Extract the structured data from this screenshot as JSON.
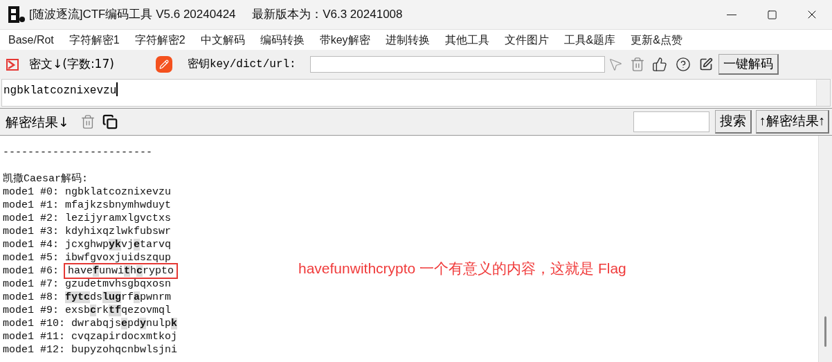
{
  "window": {
    "title": "[随波逐流]CTF编码工具 V5.6 20240424     最新版本为：V6.3 20241008"
  },
  "menu": [
    "Base/Rot",
    "字符解密1",
    "字符解密2",
    "中文解码",
    "编码转换",
    "带key解密",
    "进制转换",
    "其他工具",
    "文件图片",
    "工具&题库",
    "更新&点赞"
  ],
  "toolbar": {
    "cipher_label": "密文↓(字数:17)",
    "key_label": "密钥key/dict/url:",
    "decode_button": "一键解码"
  },
  "input": {
    "value": "ngbklatcoznixevzu"
  },
  "results_bar": {
    "label": "解密结果↓",
    "search_button": "搜索",
    "back_button": "↑解密结果↑"
  },
  "results": [
    {
      "kind": "text",
      "text": "------------------------"
    },
    {
      "kind": "blank"
    },
    {
      "kind": "text",
      "text": "凯撒Caesar解码:"
    },
    {
      "kind": "text",
      "text": "mode1 #0: ngbklatcoznixevzu"
    },
    {
      "kind": "text",
      "text": "mode1 #1: mfajkzsbnymhwduyt"
    },
    {
      "kind": "text",
      "text": "mode1 #2: lezijyramxlgvctxs"
    },
    {
      "kind": "text",
      "text": "mode1 #3: kdyhixqzlwkfubswr"
    },
    {
      "kind": "text",
      "text": "mode1 #4: jcxghwp**yk**vj**e**tarvq"
    },
    {
      "kind": "text",
      "text": "mode1 #5: ibwfgvoxjuidszqup"
    },
    {
      "kind": "text",
      "prefix": "mode1 #6: ",
      "text": "have**f**unwi**t**h**c**rypto",
      "boxed": true
    },
    {
      "kind": "text",
      "text": "mode1 #7: gzudetmvhsgbqxosn"
    },
    {
      "kind": "text",
      "text": "mode1 #8: **fytc**ds**lug**rf**a**pwnrm"
    },
    {
      "kind": "text",
      "text": "mode1 #9: exsb**c**rk**tf**qezovmql"
    },
    {
      "kind": "text",
      "text": "mode1 #10: dwrabqjs**e**pd**y**nulp**k**"
    },
    {
      "kind": "text",
      "text": "mode1 #11: cvqzapirdocxmtkoj"
    },
    {
      "kind": "text",
      "text": "mode1 #12: bupyzohqcnbwlsjni"
    }
  ],
  "annotation": {
    "text": "havefunwithcrypto 一个有意义的内容，这就是 Flag"
  }
}
